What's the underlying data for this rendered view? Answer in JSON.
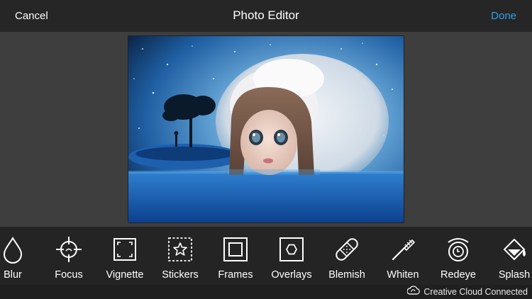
{
  "header": {
    "cancel_label": "Cancel",
    "title": "Photo Editor",
    "done_label": "Done"
  },
  "tools": [
    {
      "label": "Blur",
      "icon": "blur-drop-icon"
    },
    {
      "label": "Focus",
      "icon": "focus-crosshair-icon"
    },
    {
      "label": "Vignette",
      "icon": "vignette-frame-icon"
    },
    {
      "label": "Stickers",
      "icon": "sticker-star-icon"
    },
    {
      "label": "Frames",
      "icon": "frames-icon"
    },
    {
      "label": "Overlays",
      "icon": "overlay-hexagon-icon"
    },
    {
      "label": "Blemish",
      "icon": "bandage-icon"
    },
    {
      "label": "Whiten",
      "icon": "toothbrush-icon"
    },
    {
      "label": "Redeye",
      "icon": "redeye-icon"
    },
    {
      "label": "Splash",
      "icon": "paint-bucket-icon"
    }
  ],
  "status": {
    "creative_cloud_label": "Creative Cloud Connected"
  },
  "colors": {
    "accent": "#2fa0e8",
    "toolbar_bg": "#242424",
    "canvas_bg": "#3e3e3e"
  }
}
